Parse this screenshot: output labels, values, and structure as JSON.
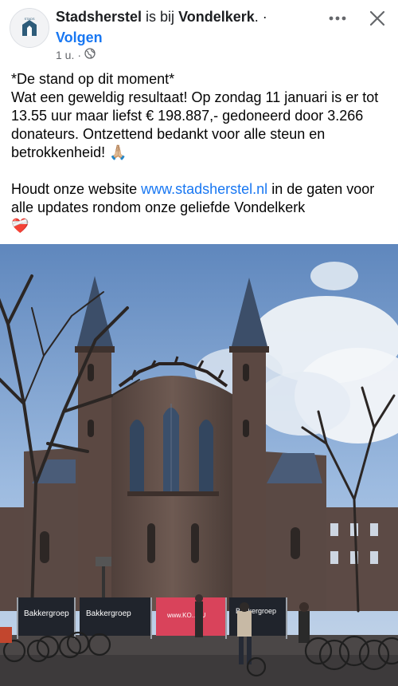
{
  "header": {
    "page_name": "Stadsherstel",
    "connector": " is bij ",
    "place_name": "Vondelkerk",
    "suffix": ". ·",
    "follow_label": "Volgen",
    "time": "1 u.",
    "separator": "·",
    "audience_icon": "globe-icon",
    "more_icon": "more-horizontal-icon",
    "close_icon": "close-icon"
  },
  "post": {
    "line1": "*De stand op dit moment*",
    "para1_before": "Wat een geweldig resultaat! Op zondag 11 januari is er tot 13.55 uur maar liefst € 198.887,- gedoneerd door 3.266 donateurs. Ontzettend bedankt voor alle steun en betrokkenheid! ",
    "para1_emoji": "🙏🏼",
    "para2_before": "Houdt onze website ",
    "link_text": "www.stadsherstel.nl",
    "para2_after": " in de gaten voor alle updates rondom onze geliefde Vondelkerk",
    "heart_emoji": "❤️‍🩹"
  },
  "photo": {
    "banners": [
      "Bakkergroep",
      "Bakkergroep",
      "www.KO...EU",
      "Bakkergroep"
    ],
    "colors": {
      "sky": "#7fa3cf",
      "brick": "#6e5a52",
      "banner_red": "#d9435b"
    }
  }
}
